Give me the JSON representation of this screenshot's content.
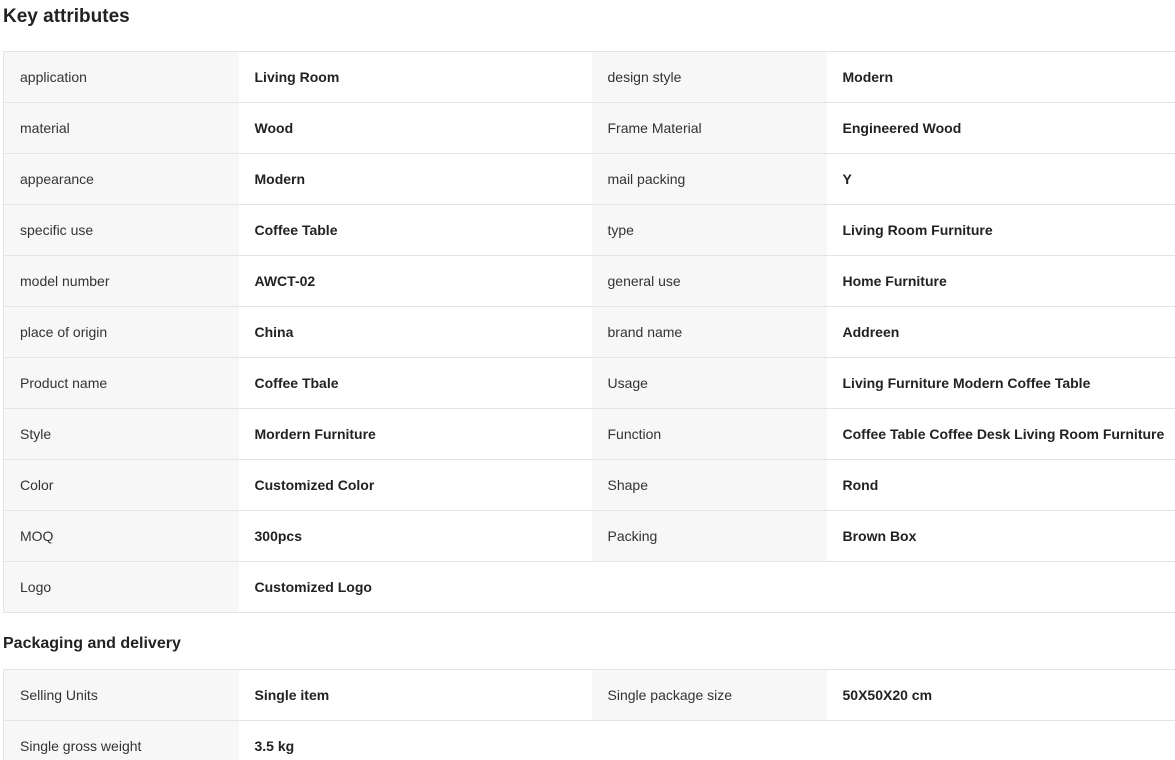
{
  "key_attributes": {
    "title": "Key attributes",
    "rows": [
      {
        "k1": "application",
        "v1": "Living Room",
        "k2": "design style",
        "v2": "Modern"
      },
      {
        "k1": "material",
        "v1": "Wood",
        "k2": "Frame Material",
        "v2": "Engineered Wood"
      },
      {
        "k1": "appearance",
        "v1": "Modern",
        "k2": "mail packing",
        "v2": "Y"
      },
      {
        "k1": "specific use",
        "v1": "Coffee Table",
        "k2": "type",
        "v2": "Living Room Furniture"
      },
      {
        "k1": "model number",
        "v1": "AWCT-02",
        "k2": "general use",
        "v2": "Home Furniture"
      },
      {
        "k1": "place of origin",
        "v1": "China",
        "k2": "brand name",
        "v2": "Addreen"
      },
      {
        "k1": "Product name",
        "v1": "Coffee Tbale",
        "k2": "Usage",
        "v2": "Living Furniture Modern Coffee Table"
      },
      {
        "k1": "Style",
        "v1": "Mordern Furniture",
        "k2": "Function",
        "v2": "Coffee Table Coffee Desk Living Room Furniture"
      },
      {
        "k1": "Color",
        "v1": "Customized Color",
        "k2": "Shape",
        "v2": "Rond"
      },
      {
        "k1": "MOQ",
        "v1": "300pcs",
        "k2": "Packing",
        "v2": "Brown Box"
      },
      {
        "k1": "Logo",
        "v1": "Customized Logo"
      }
    ]
  },
  "packaging_delivery": {
    "title": "Packaging and delivery",
    "rows": [
      {
        "k1": "Selling Units",
        "v1": "Single item",
        "k2": "Single package size",
        "v2": "50X50X20 cm"
      },
      {
        "k1": "Single gross weight",
        "v1": "3.5 kg"
      }
    ]
  }
}
